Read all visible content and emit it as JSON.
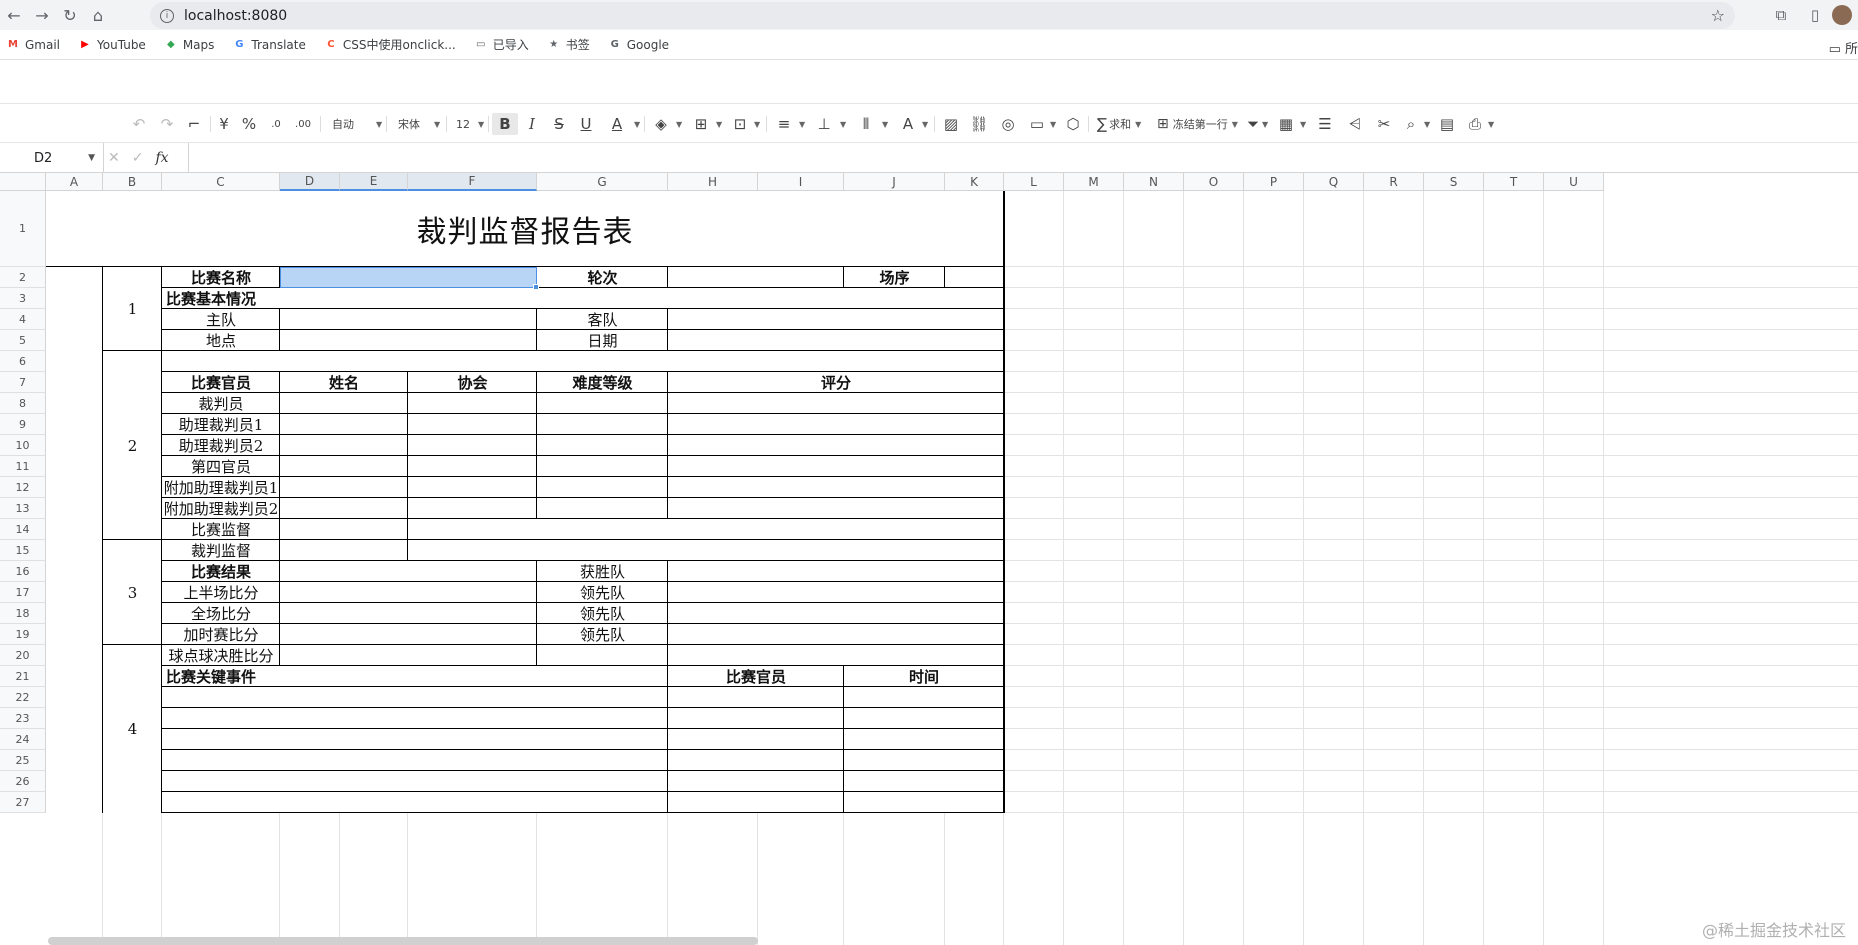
{
  "browser": {
    "url": "localhost:8080",
    "bookmarks": [
      {
        "label": "Gmail",
        "icon": "gmail-icon",
        "badge": "M",
        "color": "#ea4335"
      },
      {
        "label": "YouTube",
        "icon": "youtube-icon",
        "badge": "▶",
        "color": "#ff0000"
      },
      {
        "label": "Maps",
        "icon": "maps-icon",
        "badge": "◆",
        "color": "#34a853"
      },
      {
        "label": "Translate",
        "icon": "translate-icon",
        "badge": "G",
        "color": "#4285f4"
      },
      {
        "label": "CSS中使用onclick...",
        "icon": "csdn-icon",
        "badge": "C",
        "color": "#fc5531"
      },
      {
        "label": "已导入",
        "icon": "folder-icon",
        "badge": "▭",
        "color": "#5f6368"
      },
      {
        "label": "书签",
        "icon": "star-icon",
        "badge": "★",
        "color": "#5f6368"
      },
      {
        "label": "Google",
        "icon": "google-icon",
        "badge": "G",
        "color": "#5f6368"
      }
    ],
    "bookmarks_right": "所"
  },
  "toolbar": {
    "format_auto": "自动",
    "font": "宋体",
    "font_size": "12",
    "sum": "求和",
    "freeze": "冻结第一行"
  },
  "formula_bar": {
    "cell_ref": "D2",
    "fx": "fx"
  },
  "columns": [
    "A",
    "B",
    "C",
    "D",
    "E",
    "F",
    "G",
    "H",
    "I",
    "J",
    "K",
    "L",
    "M",
    "N",
    "O",
    "P",
    "Q",
    "R",
    "S",
    "T",
    "U"
  ],
  "rows": [
    "1",
    "2",
    "3",
    "4",
    "5",
    "6",
    "7",
    "8",
    "9",
    "10",
    "11",
    "12",
    "13",
    "14",
    "15",
    "16",
    "17",
    "18",
    "19",
    "20",
    "21",
    "22",
    "23",
    "24",
    "25",
    "26",
    "27"
  ],
  "sheet": {
    "title": "裁判监督报告表",
    "section_numbers": [
      "1",
      "2",
      "3",
      "4"
    ],
    "r2": {
      "match_name": "比赛名称",
      "round": "轮次",
      "order": "场序"
    },
    "r3": "比赛基本情况",
    "r4": {
      "home": "主队",
      "away": "客队"
    },
    "r5": {
      "venue": "地点",
      "date": "日期"
    },
    "r7": {
      "official": "比赛官员",
      "name": "姓名",
      "assoc": "协会",
      "difficulty": "难度等级",
      "score": "评分"
    },
    "officials": [
      "裁判员",
      "助理裁判员1",
      "助理裁判员2",
      "第四官员",
      "附加助理裁判员1",
      "附加助理裁判员2",
      "比赛监督",
      "裁判监督"
    ],
    "r16": {
      "result": "比赛结果",
      "winner": "获胜队"
    },
    "results": [
      {
        "label": "上半场比分",
        "lead": "领先队"
      },
      {
        "label": "全场比分",
        "lead": "领先队"
      },
      {
        "label": "加时赛比分",
        "lead": "领先队"
      },
      {
        "label": "球点球决胜比分",
        "lead": ""
      }
    ],
    "r21": {
      "events": "比赛关键事件",
      "official": "比赛官员",
      "time": "时间"
    }
  },
  "watermark": "@稀土掘金技术社区"
}
